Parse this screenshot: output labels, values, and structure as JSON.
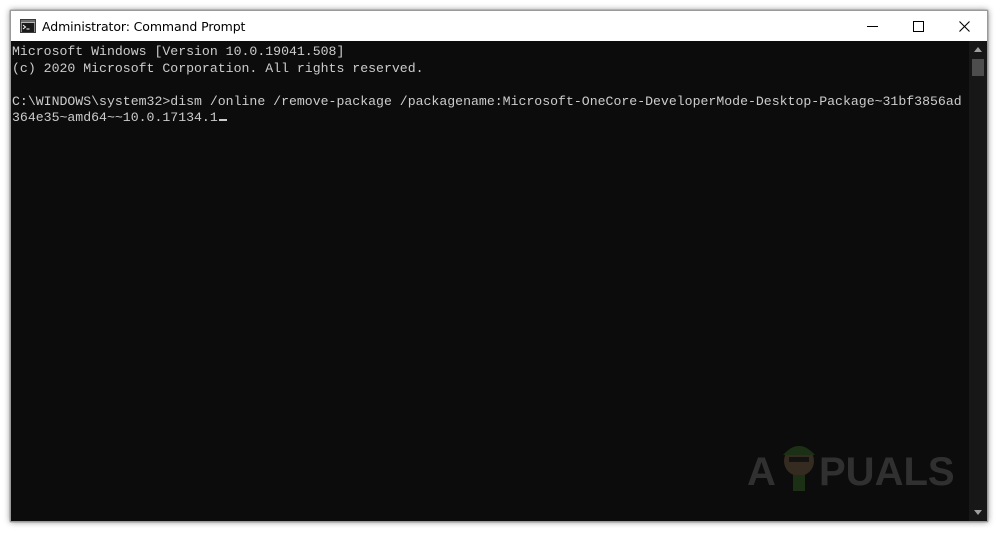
{
  "window": {
    "title": "Administrator: Command Prompt",
    "icon": "cmd-app-icon",
    "controls": [
      "minimize-icon",
      "maximize-icon",
      "close-icon"
    ]
  },
  "console": {
    "lines": [
      "Microsoft Windows [Version 10.0.19041.508]",
      "(c) 2020 Microsoft Corporation. All rights reserved.",
      "",
      "C:\\WINDOWS\\system32>dism /online /remove-package /packagename:Microsoft-OneCore-DeveloperMode-Desktop-Package~31bf3856ad",
      "364e35~amd64~~10.0.17134.1"
    ],
    "text_color": "#cccccc",
    "background": "#0c0c0c"
  },
  "watermark": {
    "text": "APPUALS"
  }
}
